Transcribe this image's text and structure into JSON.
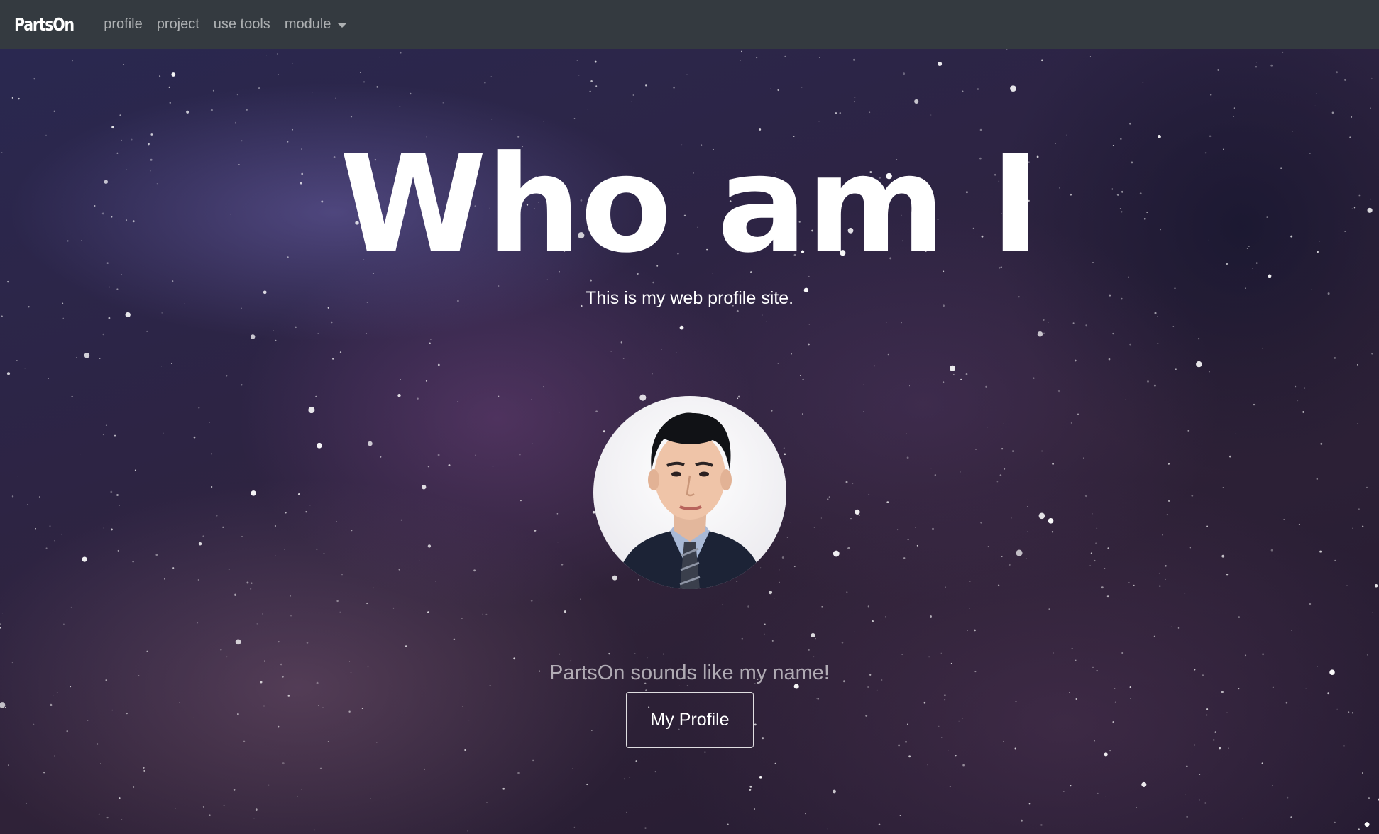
{
  "navbar": {
    "brand": "PartsOn",
    "links": [
      {
        "label": "profile"
      },
      {
        "label": "project"
      },
      {
        "label": "use tools"
      },
      {
        "label": "module",
        "dropdown": true
      }
    ]
  },
  "hero": {
    "title": "Who am I",
    "subtitle": "This is my web profile site.",
    "avatar_alt": "profile photo",
    "tagline": "PartsOn sounds like my name!",
    "button_label": "My Profile"
  },
  "colors": {
    "navbar_bg": "#343a40",
    "nav_link": "rgba(255,255,255,0.6)",
    "text": "#ffffff"
  },
  "icons": {
    "dropdown": "caret-down-icon"
  }
}
